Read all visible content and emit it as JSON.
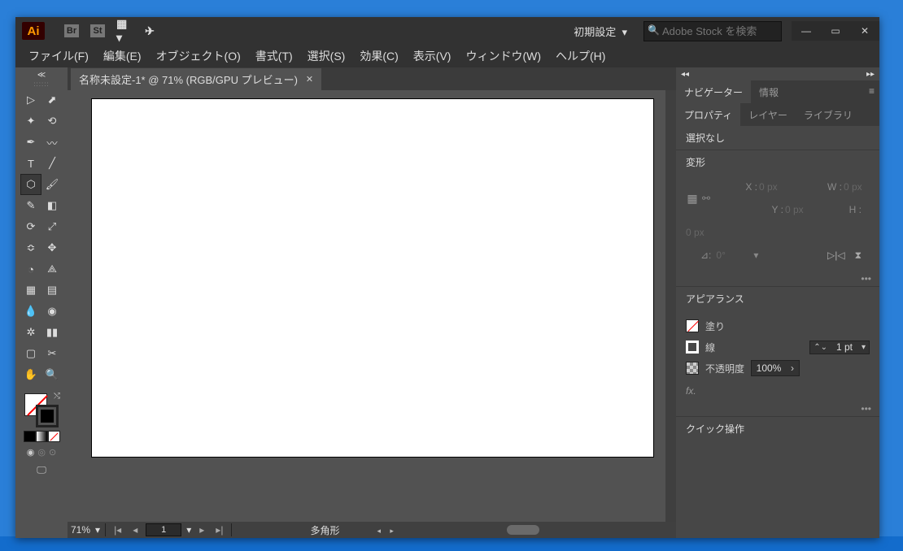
{
  "titlebar": {
    "workspace_label": "初期設定",
    "search_placeholder": "Adobe Stock を検索"
  },
  "menubar": {
    "file": "ファイル(F)",
    "edit": "編集(E)",
    "object": "オブジェクト(O)",
    "type": "書式(T)",
    "select": "選択(S)",
    "effect": "効果(C)",
    "view": "表示(V)",
    "window": "ウィンドウ(W)",
    "help": "ヘルプ(H)"
  },
  "document": {
    "tab_label": "名称未設定-1* @ 71% (RGB/GPU プレビュー)"
  },
  "status": {
    "zoom": "71%",
    "page": "1",
    "tool_name": "多角形"
  },
  "right_panel": {
    "tabs1": {
      "navigator": "ナビゲーター",
      "info": "情報"
    },
    "tabs2": {
      "properties": "プロパティ",
      "layers": "レイヤー",
      "library": "ライブラリ"
    },
    "no_selection": "選択なし",
    "transform_title": "変形",
    "x_label": "X :",
    "y_label": "Y :",
    "w_label": "W :",
    "h_label": "H :",
    "x_val": "0 px",
    "y_val": "0 px",
    "w_val": "0 px",
    "h_val": "0 px",
    "angle_val": "0°",
    "appearance_title": "アピアランス",
    "fill_label": "塗り",
    "stroke_label": "線",
    "stroke_val": "1 pt",
    "opacity_label": "不透明度",
    "opacity_val": "100%",
    "fx_label": "fx.",
    "quick_actions": "クイック操作"
  }
}
